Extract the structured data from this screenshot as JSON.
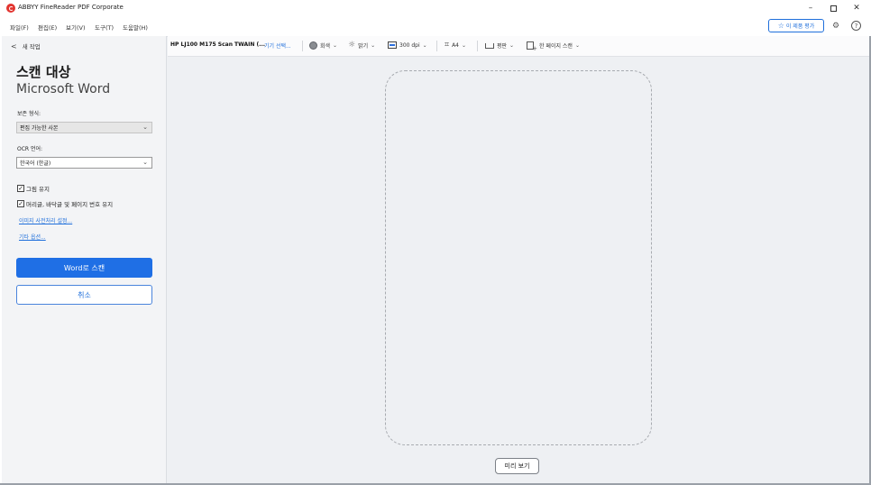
{
  "window": {
    "title": "ABBYY FineReader PDF Corporate",
    "minimize": "–",
    "close": "✕"
  },
  "menu": {
    "items": [
      "파일(F)",
      "편집(E)",
      "보기(V)",
      "도구(T)",
      "도움말(H)"
    ],
    "rate_label": "이 제품 평가",
    "help": "?",
    "gear": "⚙"
  },
  "sidebar": {
    "back_label": "새 작업",
    "title": "스캔 대상",
    "subtitle": "Microsoft Word",
    "save_format_label": "보존 형식:",
    "save_format_value": "편집 가능한 사본",
    "ocr_label": "OCR 언어:",
    "ocr_value": "한국어 (한글)",
    "keep_pictures_label": "그림 유지",
    "keep_headers_label": "머리글, 바닥글 및 페이지 번호 유지",
    "preprocess_link": "이미지 사전처리 설정...",
    "more_options_link": "기타 옵션...",
    "scan_button": "Word로 스캔",
    "cancel_button": "취소",
    "keep_pictures_checked": true,
    "keep_headers_checked": true
  },
  "toolbar": {
    "device": "HP LJ100 M175 Scan TWAIN (...",
    "select_device": "기기 선택...",
    "color_mode": "회색",
    "brightness": "밝기",
    "resolution": "300 dpi",
    "paper_size": "A4",
    "source": "평판",
    "page_mode": "한 페이지 스캔"
  },
  "canvas": {
    "preview_button": "미리 보기"
  },
  "colors": {
    "accent": "#1f6fe5",
    "link": "#1f6fdb",
    "logo": "#e2342f"
  }
}
